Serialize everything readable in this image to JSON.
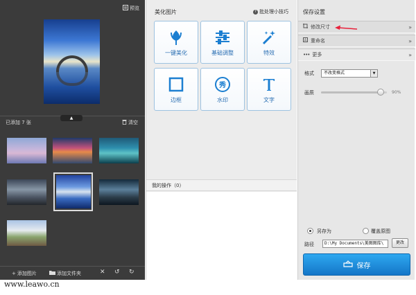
{
  "left": {
    "preview_label": "预览",
    "count_label": "已添加 7 张",
    "clear_label": "清空",
    "add_image_label": "添加图片",
    "add_folder_label": "添加文件夹"
  },
  "middle": {
    "title": "美化图片",
    "tips_label": "批处理小技巧",
    "tools": [
      {
        "label": "一键美化",
        "icon": "tulip-icon"
      },
      {
        "label": "基础调整",
        "icon": "sliders-icon"
      },
      {
        "label": "特效",
        "icon": "magic-wand-icon"
      },
      {
        "label": "边框",
        "icon": "frame-icon"
      },
      {
        "label": "水印",
        "icon": "watermark-icon"
      },
      {
        "label": "文字",
        "icon": "text-icon"
      }
    ],
    "ops_label": "我的操作（0）"
  },
  "right": {
    "title": "保存设置",
    "resize_label": "修改尺寸",
    "rename_label": "重命名",
    "more_label": "更多",
    "format_label": "格式",
    "format_value": "不改变格式",
    "quality_label": "画质",
    "quality_value": "90%",
    "quality_fraction": 0.9,
    "save_as_label": "另存为",
    "overwrite_label": "覆盖原图",
    "path_label": "路径",
    "path_value": "D:\\My Documents\\美图图库\\",
    "change_label": "更改",
    "save_label": "保存"
  },
  "colors": {
    "accent": "#2a8fe0",
    "annotation": "#e8203a"
  },
  "watermark": "www.leawo.cn"
}
